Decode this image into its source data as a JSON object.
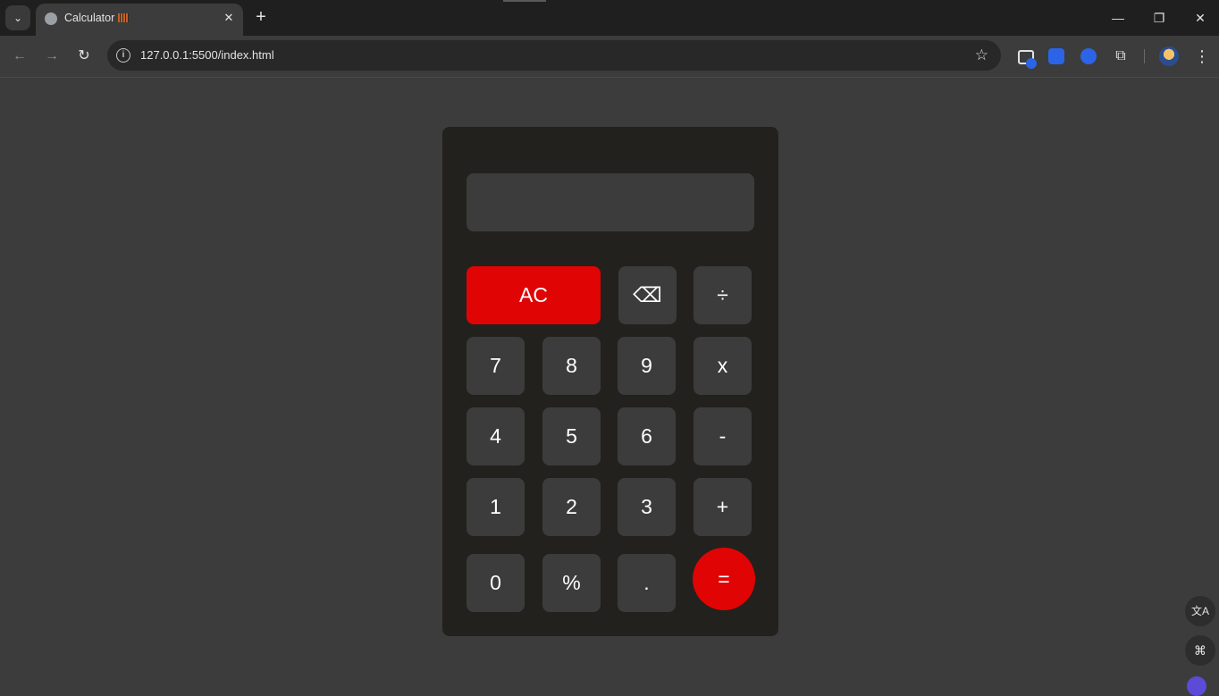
{
  "browser": {
    "tab": {
      "title": "Calculator",
      "close_glyph": "✕",
      "favicon": "globe-icon"
    },
    "new_tab_glyph": "+",
    "tab_search_glyph": "⌄",
    "window_controls": {
      "minimize": "—",
      "restore": "❐",
      "close": "✕"
    },
    "nav": {
      "back": "←",
      "forward": "→",
      "reload": "↻"
    },
    "omnibox": {
      "info_glyph": "i",
      "url": "127.0.0.1:5500/index.html",
      "star_glyph": "☆"
    },
    "menu_glyph": "⋮",
    "accent_color": "#2b64e6"
  },
  "calculator": {
    "display_value": "",
    "keys": {
      "ac": "AC",
      "backspace": "⌫",
      "divide": "÷",
      "seven": "7",
      "eight": "8",
      "nine": "9",
      "multiply": "x",
      "four": "4",
      "five": "5",
      "six": "6",
      "minus": "-",
      "one": "1",
      "two": "2",
      "three": "3",
      "plus": "+",
      "zero": "0",
      "percent": "%",
      "decimal": ".",
      "equals": "="
    },
    "colors": {
      "body": "#22211d",
      "key": "#3c3c3c",
      "accent": "#e00404"
    }
  },
  "side_widgets": {
    "translate_glyph": "文A",
    "apps_glyph": "⌘"
  }
}
